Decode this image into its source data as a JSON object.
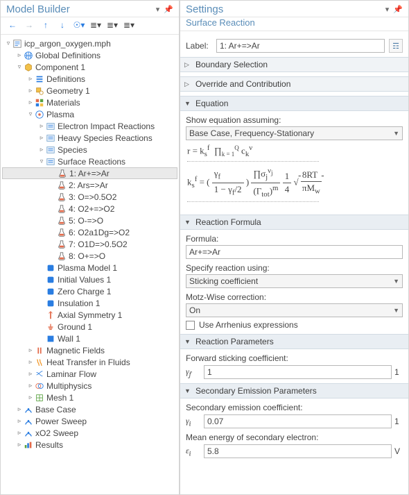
{
  "left_panel": {
    "title": "Model Builder",
    "toolbar": {
      "back_icon": "←",
      "fwd_icon": "→",
      "up_icon": "↑",
      "down_icon": "↓",
      "eye_icon": "☉▾",
      "list1_icon": "≣▾",
      "list2_icon": "≣▾",
      "list3_icon": "≣▾"
    },
    "tree": [
      {
        "depth": 0,
        "caret": "▿",
        "icon": "root",
        "label": "icp_argon_oxygen.mph"
      },
      {
        "depth": 1,
        "caret": "▹",
        "icon": "globe",
        "label": "Global Definitions"
      },
      {
        "depth": 1,
        "caret": "▿",
        "icon": "comp",
        "label": "Component 1"
      },
      {
        "depth": 2,
        "caret": "▹",
        "icon": "def",
        "label": "Definitions"
      },
      {
        "depth": 2,
        "caret": "▹",
        "icon": "geom",
        "label": "Geometry 1"
      },
      {
        "depth": 2,
        "caret": "▹",
        "icon": "mat",
        "label": "Materials"
      },
      {
        "depth": 2,
        "caret": "▿",
        "icon": "plasma",
        "label": "Plasma"
      },
      {
        "depth": 3,
        "caret": "▹",
        "icon": "eir",
        "label": "Electron Impact Reactions"
      },
      {
        "depth": 3,
        "caret": "▹",
        "icon": "hsr",
        "label": "Heavy Species Reactions"
      },
      {
        "depth": 3,
        "caret": "▹",
        "icon": "spec",
        "label": "Species"
      },
      {
        "depth": 3,
        "caret": "▿",
        "icon": "surf",
        "label": "Surface Reactions"
      },
      {
        "depth": 4,
        "caret": "",
        "icon": "flask",
        "label": "1: Ar+=>Ar",
        "selected": true
      },
      {
        "depth": 4,
        "caret": "",
        "icon": "flask",
        "label": "2: Ars=>Ar"
      },
      {
        "depth": 4,
        "caret": "",
        "icon": "flask",
        "label": "3: O=>0.5O2"
      },
      {
        "depth": 4,
        "caret": "",
        "icon": "flask",
        "label": "4: O2+=>O2"
      },
      {
        "depth": 4,
        "caret": "",
        "icon": "flask",
        "label": "5: O-=>O"
      },
      {
        "depth": 4,
        "caret": "",
        "icon": "flask",
        "label": "6: O2a1Dg=>O2"
      },
      {
        "depth": 4,
        "caret": "",
        "icon": "flask",
        "label": "7: O1D=>0.5O2"
      },
      {
        "depth": 4,
        "caret": "",
        "icon": "flask",
        "label": "8: O+=>O"
      },
      {
        "depth": 3,
        "caret": "",
        "icon": "pm",
        "label": "Plasma Model 1"
      },
      {
        "depth": 3,
        "caret": "",
        "icon": "iv",
        "label": "Initial Values 1"
      },
      {
        "depth": 3,
        "caret": "",
        "icon": "zc",
        "label": "Zero Charge 1"
      },
      {
        "depth": 3,
        "caret": "",
        "icon": "ins",
        "label": "Insulation 1"
      },
      {
        "depth": 3,
        "caret": "",
        "icon": "axis",
        "label": "Axial Symmetry 1"
      },
      {
        "depth": 3,
        "caret": "",
        "icon": "gnd",
        "label": "Ground 1"
      },
      {
        "depth": 3,
        "caret": "",
        "icon": "wall",
        "label": "Wall 1"
      },
      {
        "depth": 2,
        "caret": "▹",
        "icon": "mf",
        "label": "Magnetic Fields"
      },
      {
        "depth": 2,
        "caret": "▹",
        "icon": "ht",
        "label": "Heat Transfer in Fluids"
      },
      {
        "depth": 2,
        "caret": "▹",
        "icon": "lf",
        "label": "Laminar Flow"
      },
      {
        "depth": 2,
        "caret": "▹",
        "icon": "mp",
        "label": "Multiphysics"
      },
      {
        "depth": 2,
        "caret": "▹",
        "icon": "mesh",
        "label": "Mesh 1"
      },
      {
        "depth": 1,
        "caret": "▹",
        "icon": "study",
        "label": "Base Case"
      },
      {
        "depth": 1,
        "caret": "▹",
        "icon": "study",
        "label": "Power Sweep"
      },
      {
        "depth": 1,
        "caret": "▹",
        "icon": "study",
        "label": "xO2 Sweep"
      },
      {
        "depth": 1,
        "caret": "▹",
        "icon": "res",
        "label": "Results"
      }
    ]
  },
  "right_panel": {
    "title": "Settings",
    "subtitle": "Surface Reaction",
    "label_label": "Label:",
    "label_value": "1: Ar+=>Ar",
    "sections": {
      "boundary_selection": {
        "title": "Boundary Selection",
        "expanded": false
      },
      "override": {
        "title": "Override and Contribution",
        "expanded": false
      },
      "equation": {
        "title": "Equation",
        "expanded": true
      },
      "reaction_formula": {
        "title": "Reaction Formula",
        "expanded": true
      },
      "reaction_params": {
        "title": "Reaction Parameters",
        "expanded": true
      },
      "secondary_emission": {
        "title": "Secondary Emission Parameters",
        "expanded": true
      }
    },
    "equation": {
      "show_equation_label": "Show equation assuming:",
      "show_equation_value": "Base Case, Frequency-Stationary",
      "eq1_html": "r = k<sub>s</sub><sup>f</sup> &nbsp;∏<sub style='font-size:9px'>k = 1</sub><sup style='font-size:9px'>Q</sup> c<sub>k</sub><sup>ν</sup>",
      "eq2_html": "k<sub>s</sub><sup>f</sup> = ( <span style='display:inline-block;vertical-align:middle'><span style='display:block;border-bottom:1px solid #555;padding:0 3px'>γ<sub>f</sub></span><span style='display:block;padding:0 3px'>1 − γ<sub>f</sub>/2</span></span> ) <span style='display:inline-block;vertical-align:middle'><span style='display:block;border-bottom:1px solid #555;padding:0 3px'>∏σ<sub>j</sub><sup>ν<sub>j</sub></sup></span><span style='display:block;padding:0 3px'>(Γ<sub>tot</sub>)<sup>m</sup></span></span> <span style='display:inline-block;vertical-align:middle'><span style='display:block;border-bottom:1px solid #555;padding:0 3px'>1</span><span style='display:block;padding:0 3px'>4</span></span> √<span style='text-decoration:overline;display:inline-block'>&nbsp;<span style='display:inline-block;vertical-align:middle'><span style='display:block;border-bottom:1px solid #555;padding:0 2px'>8RT</span><span style='display:block;padding:0 2px'>πM<sub>w</sub></span></span>&nbsp;</span>"
    },
    "reaction_formula": {
      "formula_label": "Formula:",
      "formula_value": "Ar+=>Ar",
      "specify_label": "Specify reaction using:",
      "specify_value": "Sticking coefficient",
      "motzwise_label": "Motz-Wise correction:",
      "motzwise_value": "On",
      "arrhenius_label": "Use Arrhenius expressions",
      "arrhenius_checked": false
    },
    "reaction_params": {
      "fwd_label": "Forward sticking coefficient:",
      "fwd_symbol": "γ<sub>f</sub>",
      "fwd_value": "1",
      "fwd_unit": "1"
    },
    "secondary_emission": {
      "sec_label": "Secondary emission coefficient:",
      "sec_symbol": "γ<sub>i</sub>",
      "sec_value": "0.07",
      "sec_unit": "1",
      "mean_label": "Mean energy of secondary electron:",
      "mean_symbol": "ε<sub>i</sub>",
      "mean_value": "5.8",
      "mean_unit": "V"
    }
  }
}
